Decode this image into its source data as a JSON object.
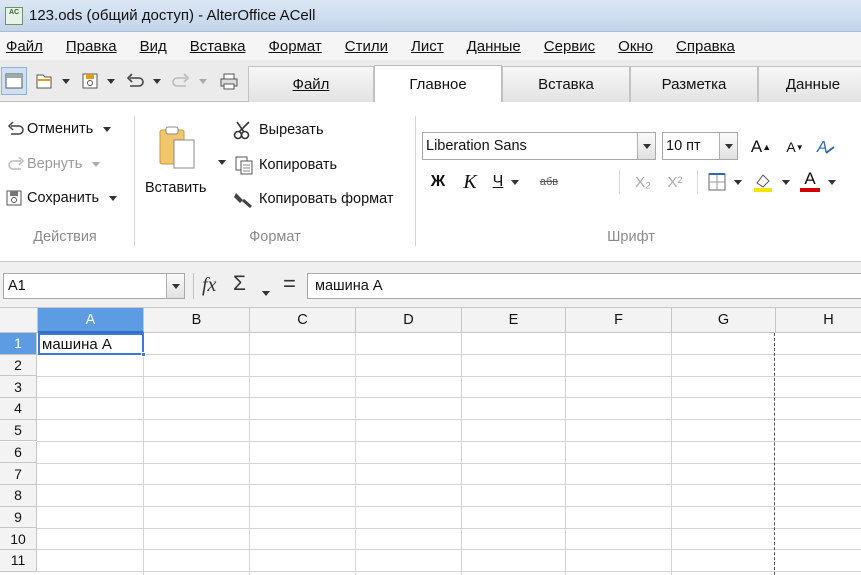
{
  "window": {
    "title": "123.ods (общий доступ) - AlterOffice ACell",
    "app_icon_text": "AC"
  },
  "menu": [
    {
      "label": "Файл"
    },
    {
      "label": "Правка"
    },
    {
      "label": "Вид"
    },
    {
      "label": "Вставка"
    },
    {
      "label": "Формат"
    },
    {
      "label": "Стили"
    },
    {
      "label": "Лист"
    },
    {
      "label": "Данные"
    },
    {
      "label": "Сервис"
    },
    {
      "label": "Окно"
    },
    {
      "label": "Справка"
    }
  ],
  "tabs": [
    {
      "label": "Файл"
    },
    {
      "label": "Главное",
      "active": true
    },
    {
      "label": "Вставка"
    },
    {
      "label": "Разметка"
    },
    {
      "label": "Данные"
    }
  ],
  "ribbon": {
    "actions": {
      "undo_label": "Отменить",
      "redo_label": "Вернуть",
      "save_label": "Сохранить",
      "group_label": "Действия"
    },
    "format": {
      "paste_label": "Вставить",
      "cut_label": "Вырезать",
      "copy_label": "Копировать",
      "format_painter_label": "Копировать формат",
      "group_label": "Формат"
    },
    "font": {
      "font_name": "Liberation Sans",
      "font_size": "10 пт",
      "bold_label": "Ж",
      "italic_label": "К",
      "underline_label": "Ч",
      "strike_label": "абв",
      "subscript_label": "X₂",
      "superscript_label": "X²",
      "grow_label": "A",
      "shrink_label": "A",
      "font_color_label": "A",
      "group_label": "Шрифт",
      "highlight_color": "#f2e600",
      "font_color": "#d40000"
    }
  },
  "formula_bar": {
    "name_box": "A1",
    "fx_label": "fx",
    "sum_label": "Σ",
    "equals_label": "=",
    "content": "машина А"
  },
  "sheet": {
    "columns": [
      "A",
      "B",
      "C",
      "D",
      "E",
      "F",
      "G",
      "H"
    ],
    "rows": [
      "1",
      "2",
      "3",
      "4",
      "5",
      "6",
      "7",
      "8",
      "9",
      "10",
      "11"
    ],
    "selected_cell": "A1",
    "cell_a1": "машина А",
    "selection_color": "#3b78d8"
  }
}
